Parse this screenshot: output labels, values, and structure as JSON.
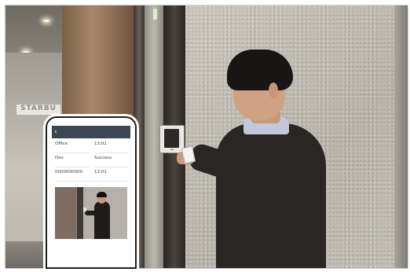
{
  "scene": {
    "signage_text": "STARBU",
    "colors": {
      "wall": "#c4c0b8",
      "pillar": "#a6876c",
      "jacket": "#2a2624",
      "shirt": "#c2c7dd",
      "app_bar": "#3d4653"
    }
  },
  "phone": {
    "back_icon": "arrow-left-icon",
    "app_title": "",
    "fields": [
      {
        "label": "",
        "value": "Office"
      },
      {
        "label": "",
        "value": "13:01"
      },
      {
        "label": "",
        "value": "Dev"
      },
      {
        "label": "",
        "value": "Success"
      },
      {
        "label": "",
        "value": "0000000000"
      },
      {
        "label": "",
        "value": "13:01"
      }
    ]
  }
}
